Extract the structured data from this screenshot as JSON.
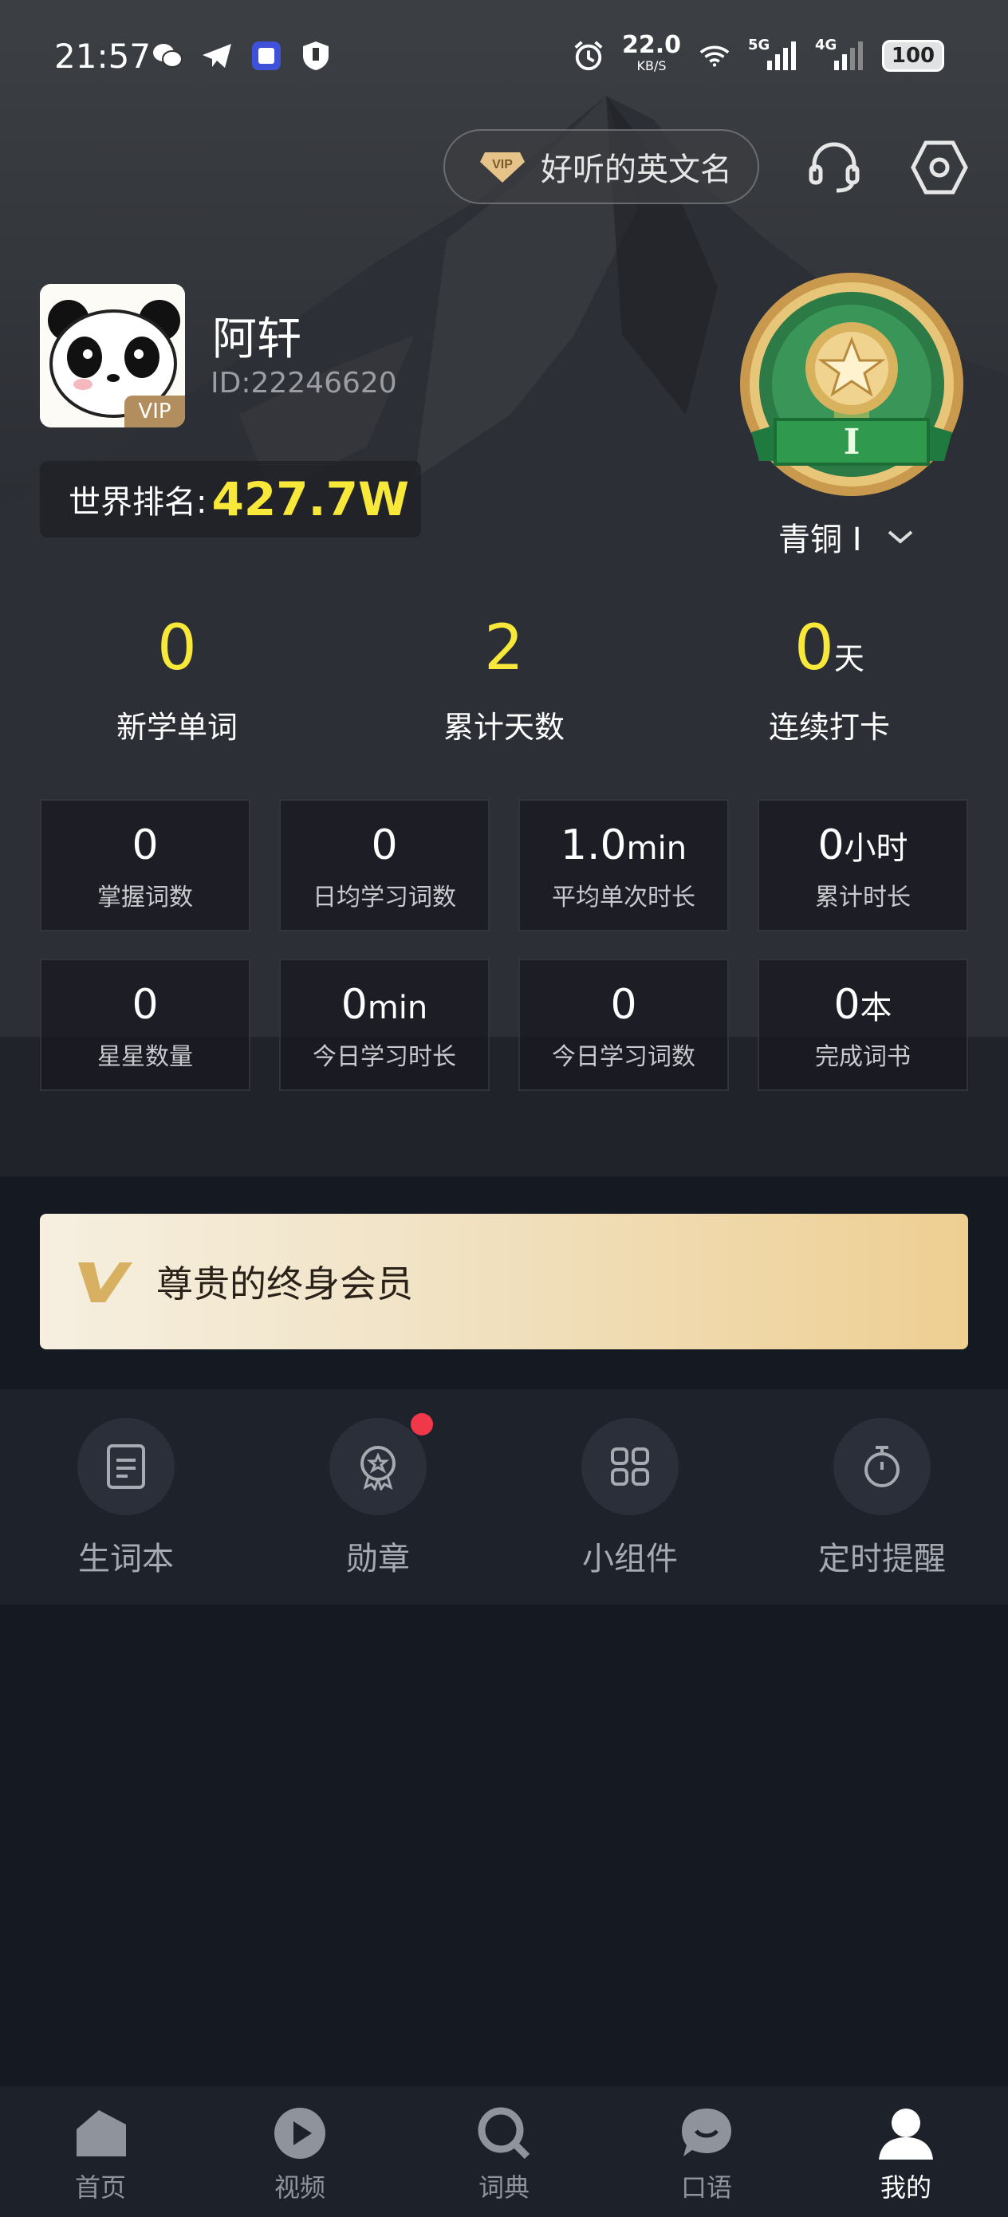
{
  "status_bar": {
    "time": "21:57",
    "speed_value": "22.0",
    "speed_unit": "KB/S",
    "net1": "5G",
    "net2": "4G",
    "battery": "100"
  },
  "header": {
    "vip_pill_label": "好听的英文名"
  },
  "profile": {
    "name": "阿轩",
    "id": "ID:22246620",
    "avatar_badge": "VIP",
    "rank_label": "世界排名:",
    "rank_value": "427.7W",
    "medal_letter": "I",
    "medal_name": "青铜 I"
  },
  "big_stats": [
    {
      "value": "0",
      "unit": "",
      "label": "新学单词"
    },
    {
      "value": "2",
      "unit": "",
      "label": "累计天数"
    },
    {
      "value": "0",
      "unit": "天",
      "label": "连续打卡"
    }
  ],
  "grid": [
    {
      "value": "0",
      "unit": "",
      "label": "掌握词数"
    },
    {
      "value": "0",
      "unit": "",
      "label": "日均学习词数"
    },
    {
      "value": "1.0",
      "unit": "min",
      "label": "平均单次时长"
    },
    {
      "value": "0",
      "unit": "小时",
      "label": "累计时长"
    },
    {
      "value": "0",
      "unit": "",
      "label": "星星数量"
    },
    {
      "value": "0",
      "unit": "min",
      "label": "今日学习时长"
    },
    {
      "value": "0",
      "unit": "",
      "label": "今日学习词数"
    },
    {
      "value": "0",
      "unit": "本",
      "label": "完成词书"
    }
  ],
  "membership": {
    "label": "尊贵的终身会员"
  },
  "tools": [
    {
      "label": "生词本",
      "icon": "notebook-icon"
    },
    {
      "label": "勋章",
      "icon": "medal-icon"
    },
    {
      "label": "小组件",
      "icon": "widgets-icon"
    },
    {
      "label": "定时提醒",
      "icon": "timer-icon"
    }
  ],
  "bottom_nav": [
    {
      "label": "首页",
      "icon": "home-icon"
    },
    {
      "label": "视频",
      "icon": "play-icon"
    },
    {
      "label": "词典",
      "icon": "search-icon"
    },
    {
      "label": "口语",
      "icon": "chat-icon"
    },
    {
      "label": "我的",
      "icon": "user-icon",
      "active": true
    }
  ],
  "colors": {
    "accent_yellow": "#f7e83a",
    "background": "#151922",
    "badge_red": "#f1374a",
    "gold": "#eecf92"
  }
}
